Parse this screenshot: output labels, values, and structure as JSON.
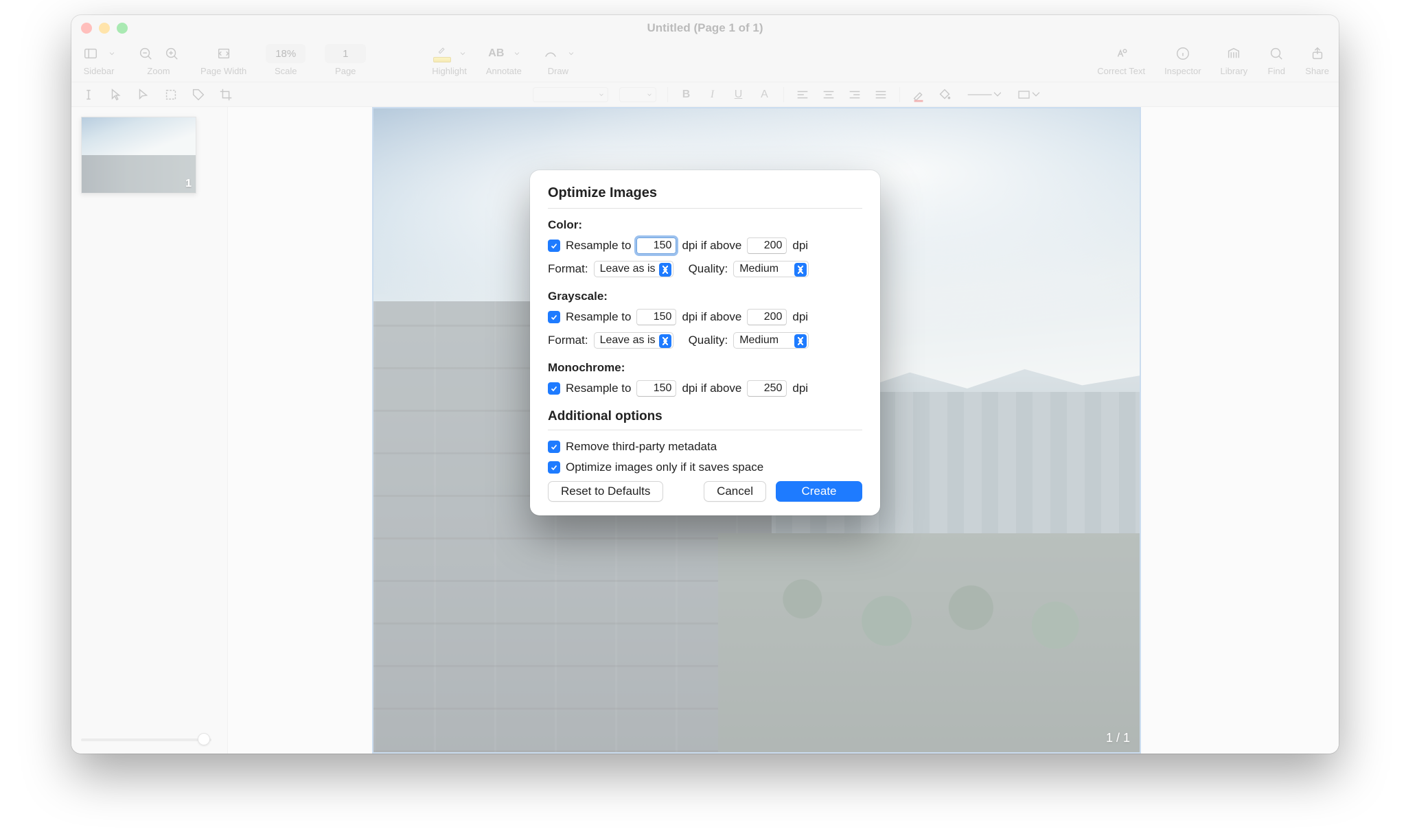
{
  "window": {
    "title": "Untitled (Page 1 of 1)"
  },
  "toolbar": {
    "sidebar": "Sidebar",
    "zoom": "Zoom",
    "page_width": "Page Width",
    "scale": "Scale",
    "scale_value": "18%",
    "page": "Page",
    "page_value": "1",
    "highlight": "Highlight",
    "annotate": "Annotate",
    "draw": "Draw",
    "correct_text": "Correct Text",
    "inspector": "Inspector",
    "library": "Library",
    "find": "Find",
    "share": "Share"
  },
  "thumb": {
    "page_number": "1"
  },
  "canvas": {
    "page_counter": "1 / 1"
  },
  "dialog": {
    "title": "Optimize Images",
    "color": {
      "heading": "Color:",
      "resample_label": "Resample to",
      "dpi1": "150",
      "mid_label": "dpi if above",
      "dpi2": "200",
      "dpi_suffix": "dpi",
      "format_label": "Format:",
      "format_value": "Leave as is",
      "quality_label": "Quality:",
      "quality_value": "Medium"
    },
    "grayscale": {
      "heading": "Grayscale:",
      "resample_label": "Resample to",
      "dpi1": "150",
      "mid_label": "dpi if above",
      "dpi2": "200",
      "dpi_suffix": "dpi",
      "format_label": "Format:",
      "format_value": "Leave as is",
      "quality_label": "Quality:",
      "quality_value": "Medium"
    },
    "mono": {
      "heading": "Monochrome:",
      "resample_label": "Resample to",
      "dpi1": "150",
      "mid_label": "dpi if above",
      "dpi2": "250",
      "dpi_suffix": "dpi"
    },
    "additional_heading": "Additional options",
    "remove_metadata": "Remove third-party metadata",
    "optimize_space": "Optimize images only if it saves space",
    "reset": "Reset to Defaults",
    "cancel": "Cancel",
    "create": "Create"
  }
}
